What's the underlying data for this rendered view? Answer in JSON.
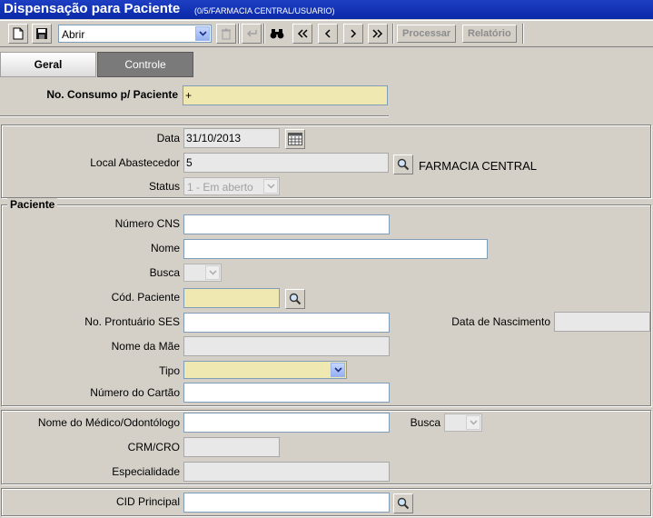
{
  "window": {
    "title": "Dispensação para Paciente",
    "subtitle": "(0/5/FARMACIA CENTRAL/USUARIO)"
  },
  "toolbar": {
    "action_value": "Abrir",
    "process_label": "Processar",
    "report_label": "Relatório"
  },
  "tabs": [
    {
      "label": "Geral",
      "active": true
    },
    {
      "label": "Controle",
      "active": false
    }
  ],
  "consumo": {
    "label": "No. Consumo p/ Paciente",
    "value": "+"
  },
  "header_section": {
    "data_label": "Data",
    "data_value": "31/10/2013",
    "local_label": "Local Abastecedor",
    "local_value": "5",
    "local_name": "FARMACIA CENTRAL",
    "status_label": "Status",
    "status_value": "1 - Em aberto"
  },
  "paciente": {
    "legend": "Paciente",
    "cns_label": "Número CNS",
    "cns_value": "",
    "nome_label": "Nome",
    "nome_value": "",
    "busca_label": "Busca",
    "cod_label": "Cód. Paciente",
    "cod_value": "",
    "prontuario_label": "No. Prontuário SES",
    "prontuario_value": "",
    "nascimento_label": "Data de Nascimento",
    "nascimento_value": "",
    "mae_label": "Nome da Mãe",
    "mae_value": "",
    "tipo_label": "Tipo",
    "tipo_value": "",
    "cartao_label": "Número do Cartão",
    "cartao_value": ""
  },
  "medico": {
    "nome_label": "Nome do Médico/Odontólogo",
    "nome_value": "",
    "busca_label": "Busca",
    "crm_label": "CRM/CRO",
    "crm_value": "",
    "especialidade_label": "Especialidade",
    "especialidade_value": ""
  },
  "cid": {
    "label": "CID Principal",
    "value": ""
  },
  "colors": {
    "titlebar": "#0b2aa8",
    "required_field": "#efe8b0",
    "background": "#d4d0c8"
  }
}
